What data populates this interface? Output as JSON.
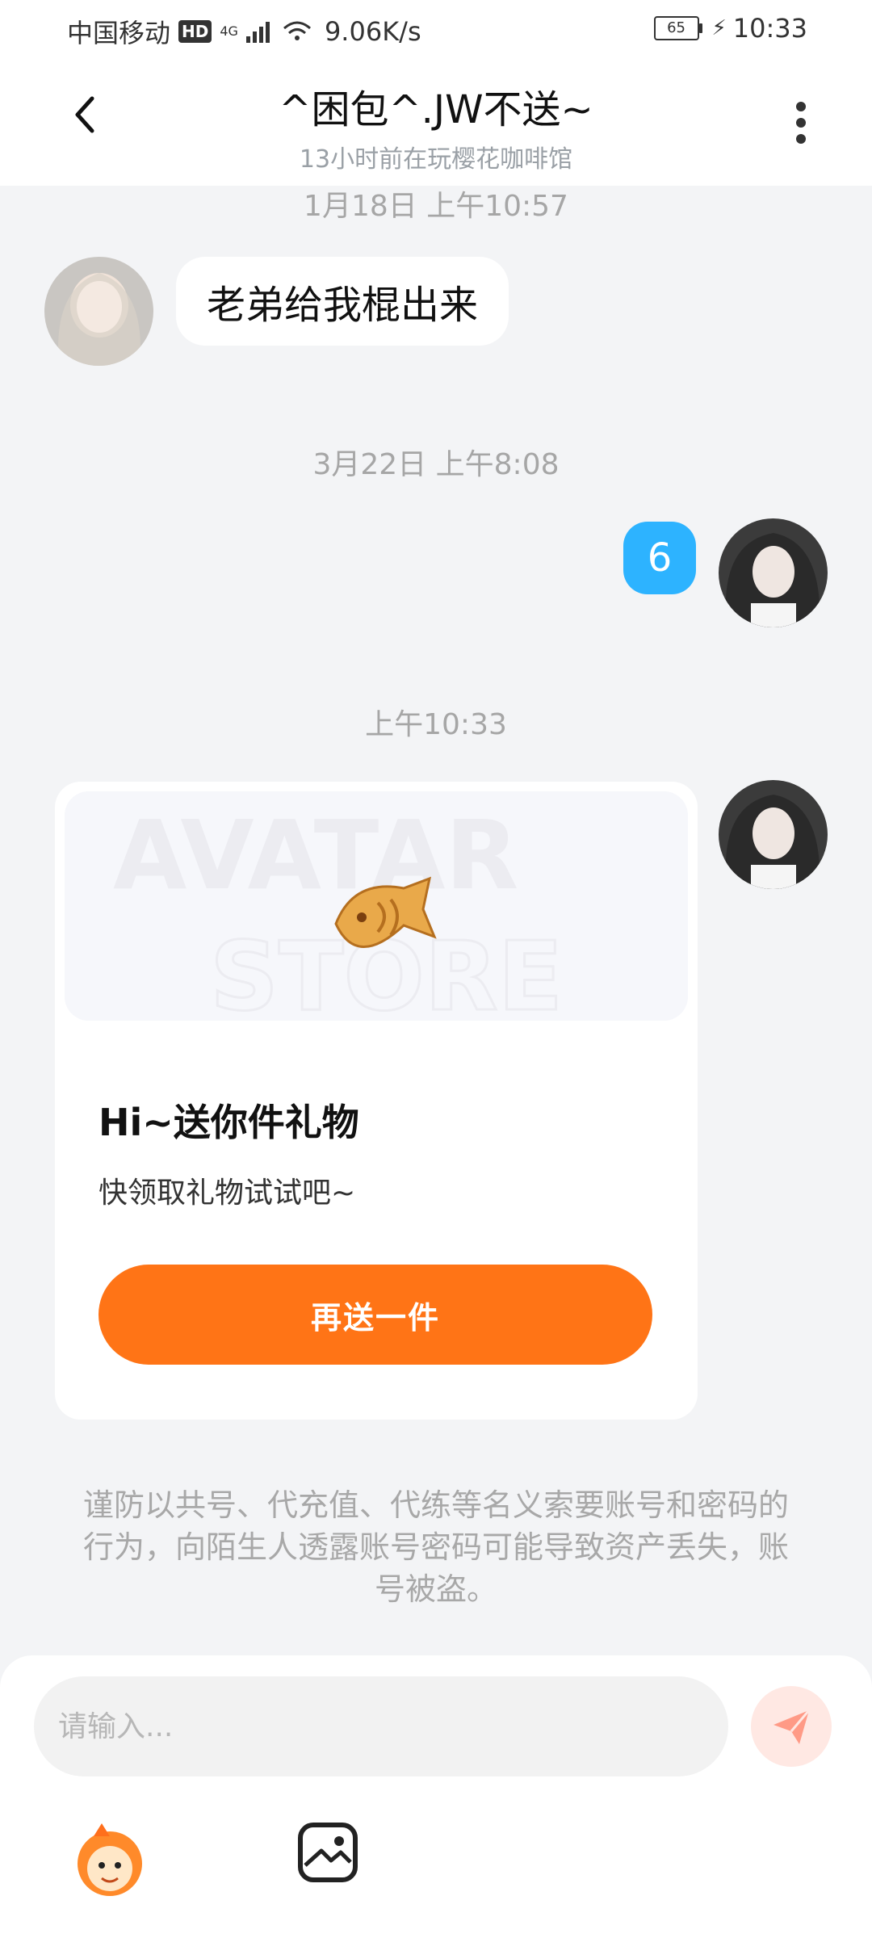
{
  "status_bar": {
    "carrier": "中国移动",
    "hd": "HD",
    "network_type": "4G",
    "speed": "9.06K/s",
    "battery": "65",
    "time": "10:33"
  },
  "header": {
    "title": "^困包^.JW不送~",
    "subtitle": "13小时前在玩樱花咖啡馆"
  },
  "chat": {
    "timestamp_1": "1月18日 上午10:57",
    "message_1": "老弟给我棍出来",
    "timestamp_2": "3月22日 上午8:08",
    "message_2": "6",
    "timestamp_3": "上午10:33"
  },
  "gift_card": {
    "banner_word_1": "AVATAR",
    "banner_word_2": "STORE",
    "title": "Hi~送你件礼物",
    "description": "快领取礼物试试吧~",
    "button_label": "再送一件"
  },
  "notice": "谨防以共号、代充值、代练等名义索要账号和密码的行为，向陌生人透露账号密码可能导致资产丢失，账号被盗。",
  "composer": {
    "placeholder": "请输入..."
  },
  "colors": {
    "accent_orange": "#ff7416",
    "bubble_blue": "#2db3ff",
    "send_bg": "#ffe8e3",
    "send_icon": "#ff9a86"
  },
  "icons": {
    "back": "chevron-left-icon",
    "more": "more-vertical-icon",
    "send": "send-icon",
    "mascot": "mascot-icon",
    "image": "image-icon",
    "gift": "fish-cookie-icon"
  }
}
